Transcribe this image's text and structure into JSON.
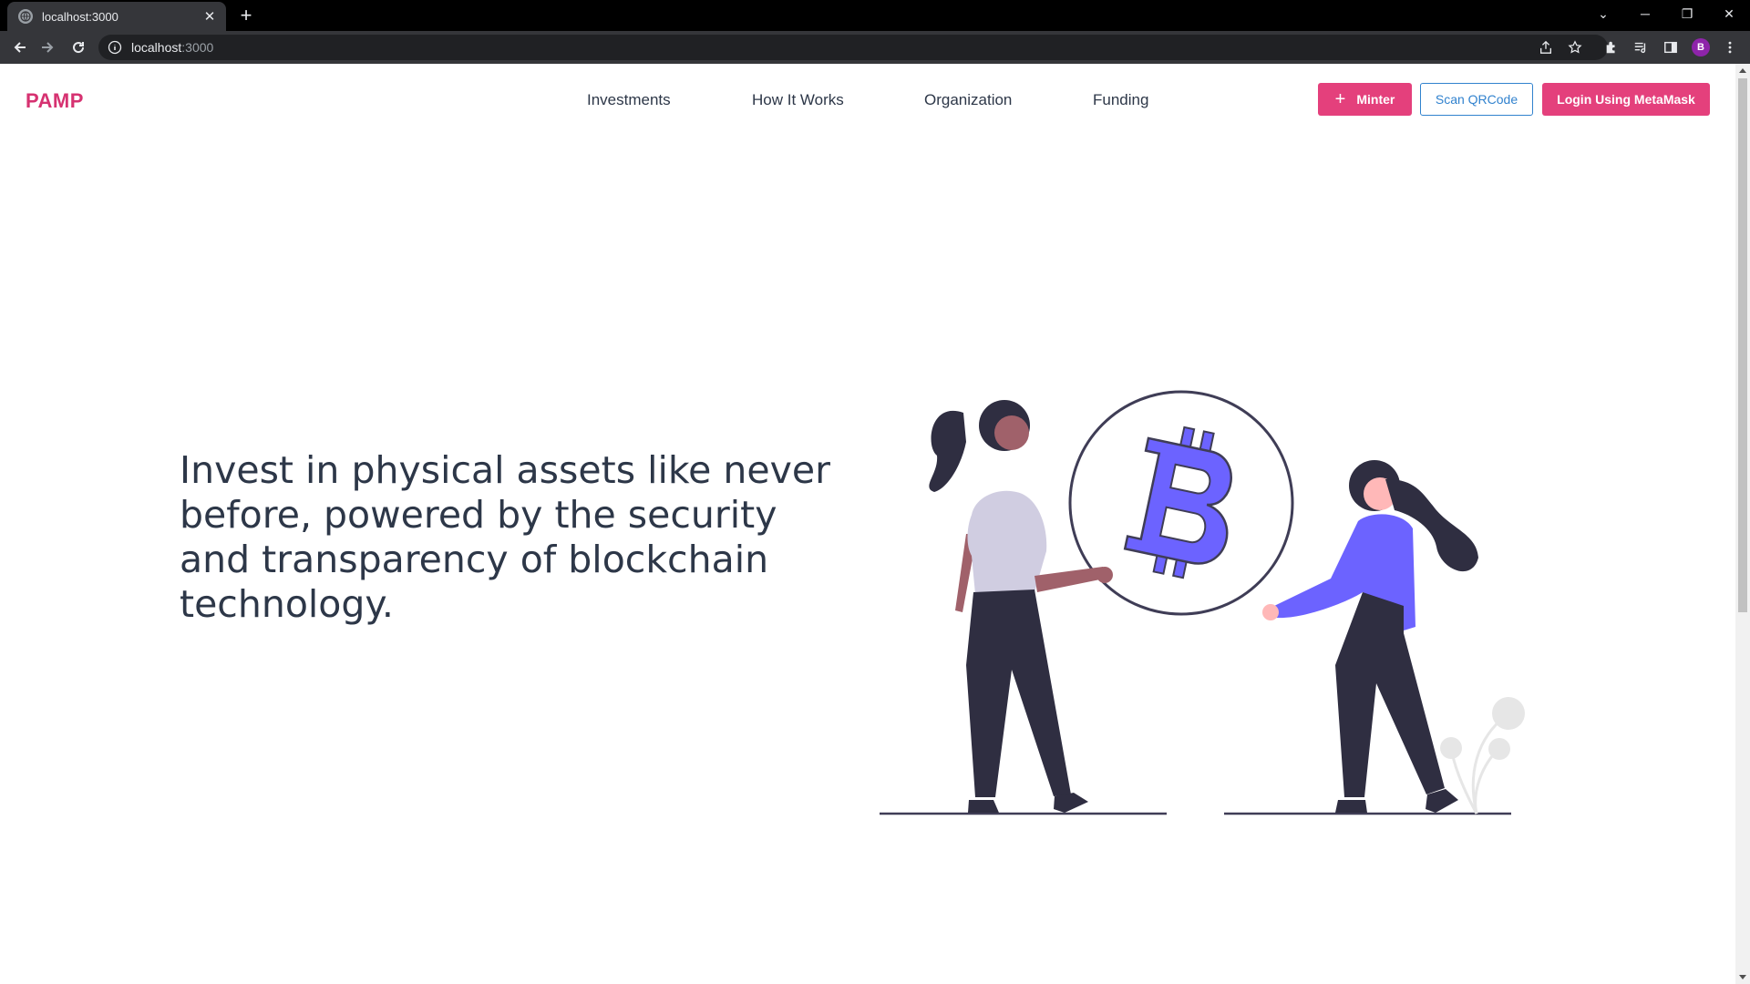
{
  "browser": {
    "tab_title": "localhost:3000",
    "url_host": "localhost",
    "url_port": ":3000",
    "profile_initial": "B"
  },
  "page": {
    "brand": "PAMP",
    "nav": [
      "Investments",
      "How It Works",
      "Organization",
      "Funding"
    ],
    "buttons": {
      "minter": "Minter",
      "scan": "Scan QRCode",
      "login": "Login Using MetaMask"
    },
    "headline": "Invest in physical assets like never before, powered by the security and transparency of blockchain technology."
  },
  "colors": {
    "brand": "#d63271",
    "primary_button": "#e4407c",
    "outline_button": "#3182ce",
    "bitcoin": "#6c63ff"
  },
  "icons": {
    "minter_icon": "plus-icon",
    "illustration": "two-women-holding-bitcoin-illustration"
  }
}
